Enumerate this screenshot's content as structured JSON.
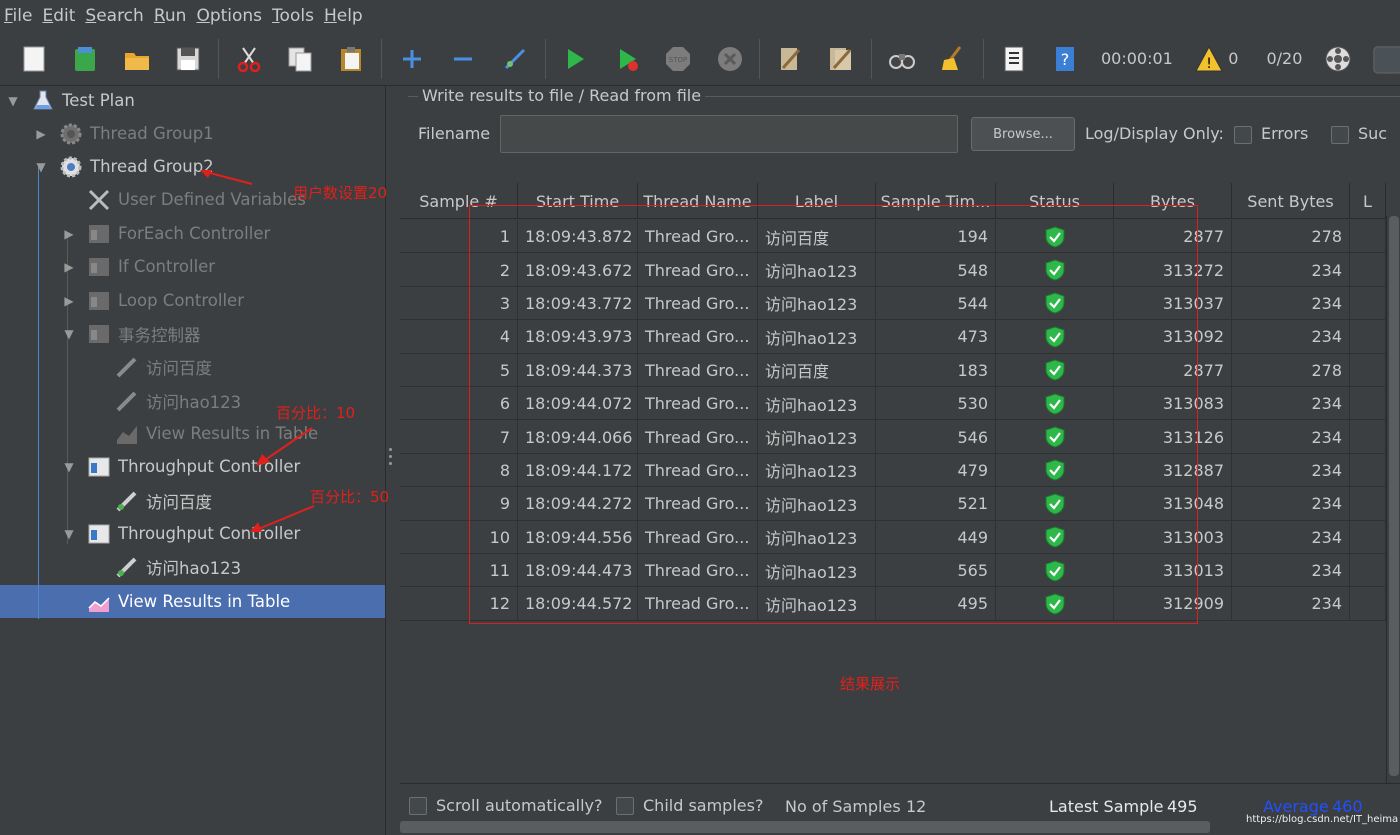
{
  "menu": [
    "File",
    "Edit",
    "Search",
    "Run",
    "Options",
    "Tools",
    "Help"
  ],
  "menu_underline": [
    "F",
    "E",
    "S",
    "R",
    "O",
    "T",
    "H"
  ],
  "menu_rest": [
    "ile",
    "dit",
    "earch",
    "un",
    "ptions",
    "ools",
    "elp"
  ],
  "toolbar": {
    "timer": "00:00:01",
    "warnings": "0",
    "threads": "0/20",
    "icons": [
      "new-icon",
      "templates-icon",
      "open-icon",
      "save-icon",
      "cut-icon",
      "copy-icon",
      "paste-icon",
      "expand-icon",
      "collapse-icon",
      "toggle-icon",
      "start-icon",
      "start-no-pause-icon",
      "stop-icon",
      "shutdown-icon",
      "clear-icon",
      "clear-all-icon",
      "search-icon",
      "reset-search-icon",
      "function-helper-icon",
      "help-icon",
      "warning-icon",
      "remote-icon"
    ]
  },
  "tree": {
    "items": [
      {
        "label": "Test Plan"
      },
      {
        "label": "Thread Group1"
      },
      {
        "label": "Thread Group2"
      },
      {
        "label": "User Defined Variables"
      },
      {
        "label": "ForEach Controller"
      },
      {
        "label": "If Controller"
      },
      {
        "label": "Loop Controller"
      },
      {
        "label": "事务控制器"
      },
      {
        "label": "访问百度"
      },
      {
        "label": "访问hao123"
      },
      {
        "label": "View Results in Table"
      },
      {
        "label": "Throughput Controller"
      },
      {
        "label": "访问百度"
      },
      {
        "label": "Throughput Controller"
      },
      {
        "label": "访问hao123"
      },
      {
        "label": "View Results in Table"
      }
    ]
  },
  "annotations": {
    "users": "用户数设置20",
    "percent10": "百分比：10",
    "percent50": "百分比：50",
    "result": "结果展示"
  },
  "file_panel": {
    "legend": "Write results to file / Read from file",
    "filename_label": "Filename",
    "filename_value": "",
    "browse": "Browse...",
    "log_display": "Log/Display Only:",
    "errors": "Errors",
    "successes": "Suc"
  },
  "table": {
    "columns": [
      "Sample #",
      "Start Time",
      "Thread Name",
      "Label",
      "Sample Tim...",
      "Status",
      "Bytes",
      "Sent Bytes",
      "L"
    ],
    "rows": [
      [
        "1",
        "18:09:43.872",
        "Thread Gro...",
        "访问百度",
        "194",
        "ok",
        "2877",
        "278"
      ],
      [
        "2",
        "18:09:43.672",
        "Thread Gro...",
        "访问hao123",
        "548",
        "ok",
        "313272",
        "234"
      ],
      [
        "3",
        "18:09:43.772",
        "Thread Gro...",
        "访问hao123",
        "544",
        "ok",
        "313037",
        "234"
      ],
      [
        "4",
        "18:09:43.973",
        "Thread Gro...",
        "访问hao123",
        "473",
        "ok",
        "313092",
        "234"
      ],
      [
        "5",
        "18:09:44.373",
        "Thread Gro...",
        "访问百度",
        "183",
        "ok",
        "2877",
        "278"
      ],
      [
        "6",
        "18:09:44.072",
        "Thread Gro...",
        "访问hao123",
        "530",
        "ok",
        "313083",
        "234"
      ],
      [
        "7",
        "18:09:44.066",
        "Thread Gro...",
        "访问hao123",
        "546",
        "ok",
        "313126",
        "234"
      ],
      [
        "8",
        "18:09:44.172",
        "Thread Gro...",
        "访问hao123",
        "479",
        "ok",
        "312887",
        "234"
      ],
      [
        "9",
        "18:09:44.272",
        "Thread Gro...",
        "访问hao123",
        "521",
        "ok",
        "313048",
        "234"
      ],
      [
        "10",
        "18:09:44.556",
        "Thread Gro...",
        "访问hao123",
        "449",
        "ok",
        "313003",
        "234"
      ],
      [
        "11",
        "18:09:44.473",
        "Thread Gro...",
        "访问hao123",
        "565",
        "ok",
        "313013",
        "234"
      ],
      [
        "12",
        "18:09:44.572",
        "Thread Gro...",
        "访问hao123",
        "495",
        "ok",
        "312909",
        "234"
      ]
    ]
  },
  "bottom": {
    "scroll_auto": "Scroll automatically?",
    "child_samples": "Child samples?",
    "no_samples_label": "No of Samples",
    "no_samples_value": "12",
    "latest_label": "Latest Sample",
    "latest_value": "495",
    "average_label": "Average",
    "average_value": "460"
  },
  "watermark": "https://blog.csdn.net/IT_heima",
  "colors": {
    "background": "#3c3f41",
    "selection": "#4b6eaf",
    "annotation": "#e0201a",
    "status_ok": "#2fb84a",
    "average": "#2050ff"
  }
}
